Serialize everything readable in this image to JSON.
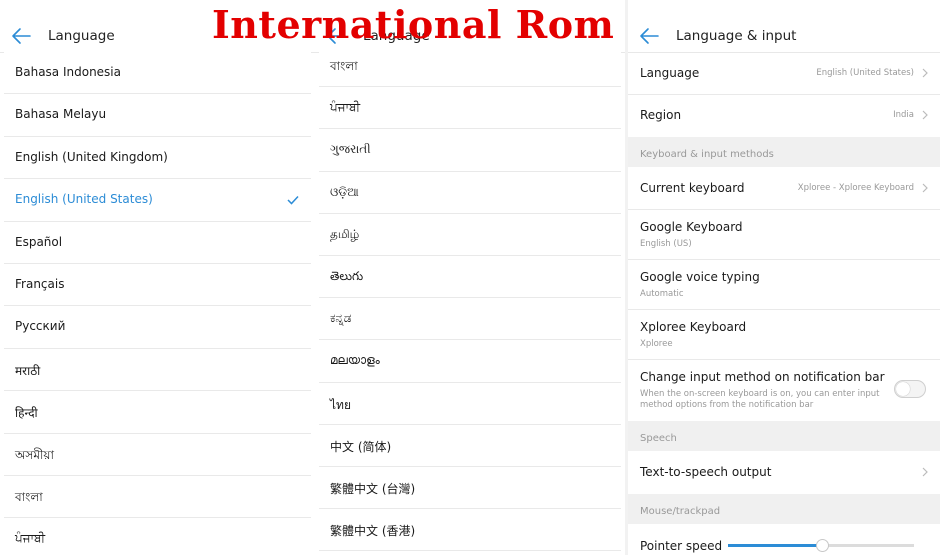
{
  "overlay": {
    "title": "International Rom"
  },
  "panel1": {
    "title": "Language",
    "items": [
      {
        "label": "Bahasa Indonesia"
      },
      {
        "label": "Bahasa Melayu"
      },
      {
        "label": "English (United Kingdom)"
      },
      {
        "label": "English (United States)",
        "selected": true
      },
      {
        "label": "Español"
      },
      {
        "label": "Français"
      },
      {
        "label": "Русский"
      },
      {
        "label": "मराठी"
      },
      {
        "label": "हिन्दी"
      },
      {
        "label": "অসমীয়া"
      },
      {
        "label": "বাংলা"
      },
      {
        "label": "ਪੰਜਾਬੀ"
      }
    ]
  },
  "panel2": {
    "title": "Language",
    "items": [
      {
        "label": "বাংলা"
      },
      {
        "label": "ਪੰਜਾਬੀ"
      },
      {
        "label": "ગુજરાતી"
      },
      {
        "label": "ଓଡ଼ିଆ"
      },
      {
        "label": "தமிழ்"
      },
      {
        "label": "తెలుగు"
      },
      {
        "label": "ಕನ್ನಡ"
      },
      {
        "label": "മലയാളം"
      },
      {
        "label": "ไทย"
      },
      {
        "label": "中文 (简体)"
      },
      {
        "label": "繁體中文 (台灣)"
      },
      {
        "label": "繁體中文 (香港)"
      }
    ]
  },
  "panel3": {
    "title": "Language & input",
    "language": {
      "label": "Language",
      "value": "English (United States)"
    },
    "region": {
      "label": "Region",
      "value": "India"
    },
    "section_keyboard": "Keyboard & input methods",
    "current_keyboard": {
      "label": "Current keyboard",
      "value": "Xploree - Xploree Keyboard"
    },
    "google_keyboard": {
      "label": "Google Keyboard",
      "sub": "English (US)"
    },
    "google_voice": {
      "label": "Google voice typing",
      "sub": "Automatic"
    },
    "xploree": {
      "label": "Xploree Keyboard",
      "sub": "Xploree"
    },
    "change_input": {
      "label": "Change input method on notification bar",
      "sub1": "When the on-screen keyboard is on, you can enter input",
      "sub2": "method options from the notification bar",
      "enabled": false
    },
    "section_speech": "Speech",
    "tts": {
      "label": "Text-to-speech output"
    },
    "section_mouse": "Mouse/trackpad",
    "pointer_speed": {
      "label": "Pointer speed",
      "level_percent": 50
    }
  },
  "colors": {
    "accent": "#2c8cd6",
    "overlay_text": "#e30000",
    "section_bg": "#f0f0f0",
    "secondary_text": "#999999"
  },
  "icons": {
    "back": "arrow-left-icon",
    "check": "check-icon",
    "chevron": "chevron-right-icon",
    "image": "image-icon"
  }
}
